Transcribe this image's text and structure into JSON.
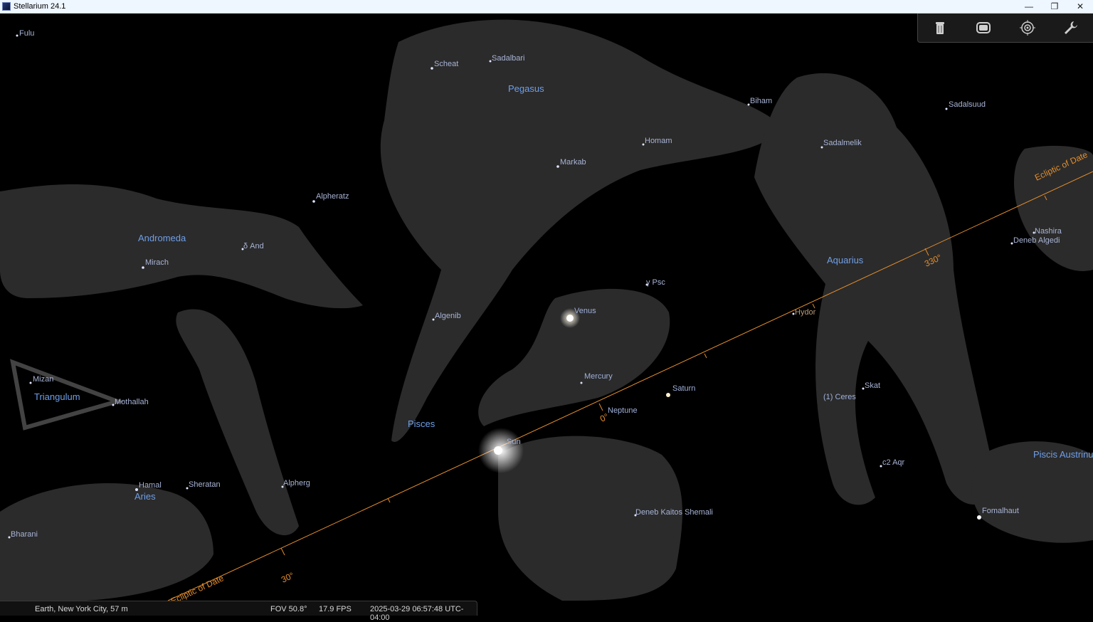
{
  "window": {
    "title": "Stellarium 24.1",
    "controls": [
      "—",
      "❐",
      "✕"
    ]
  },
  "constellations": [
    {
      "name": "Pegasus"
    },
    {
      "name": "Andromeda"
    },
    {
      "name": "Triangulum"
    },
    {
      "name": "Aries"
    },
    {
      "name": "Pisces"
    },
    {
      "name": "Aquarius"
    },
    {
      "name": "Piscis Austrinus"
    }
  ],
  "stars": [
    {
      "name": "Fulu"
    },
    {
      "name": "Scheat"
    },
    {
      "name": "Sadalbari"
    },
    {
      "name": "Biham"
    },
    {
      "name": "Sadalsuud"
    },
    {
      "name": "Sadalmelik"
    },
    {
      "name": "Homam"
    },
    {
      "name": "Markab"
    },
    {
      "name": "Alpheratz"
    },
    {
      "name": "δ And"
    },
    {
      "name": "Mirach"
    },
    {
      "name": "γ Psc"
    },
    {
      "name": "Algenib"
    },
    {
      "name": "Hydor"
    },
    {
      "name": "Nashira"
    },
    {
      "name": "Deneb Algedi"
    },
    {
      "name": "Mizan"
    },
    {
      "name": "Mothallah"
    },
    {
      "name": "Skat"
    },
    {
      "name": "c2 Aqr"
    },
    {
      "name": "Hamal"
    },
    {
      "name": "Sheratan"
    },
    {
      "name": "Alpherg"
    },
    {
      "name": "Bharani"
    },
    {
      "name": "Deneb Kaitos Shemali"
    },
    {
      "name": "Fomalhaut"
    }
  ],
  "planets": [
    {
      "name": "Venus"
    },
    {
      "name": "Mercury"
    },
    {
      "name": "Saturn"
    },
    {
      "name": "Neptune"
    },
    {
      "name": "(1) Ceres"
    },
    {
      "name": "Sun"
    }
  ],
  "ecliptic": {
    "line_name": "Ecliptic of Date",
    "degree_labels": [
      "330°",
      "0°",
      "30°"
    ],
    "color": "#e58d2c"
  },
  "toolbar": {
    "icons": [
      "trash-icon",
      "screen-icon",
      "target-icon",
      "wrench-icon"
    ]
  },
  "status": {
    "location": "Earth, New York City, 57 m",
    "fov": "FOV 50.8°",
    "fps": "17.9 FPS",
    "datetime": "2025-03-29 06:57:48 UTC-04:00"
  }
}
